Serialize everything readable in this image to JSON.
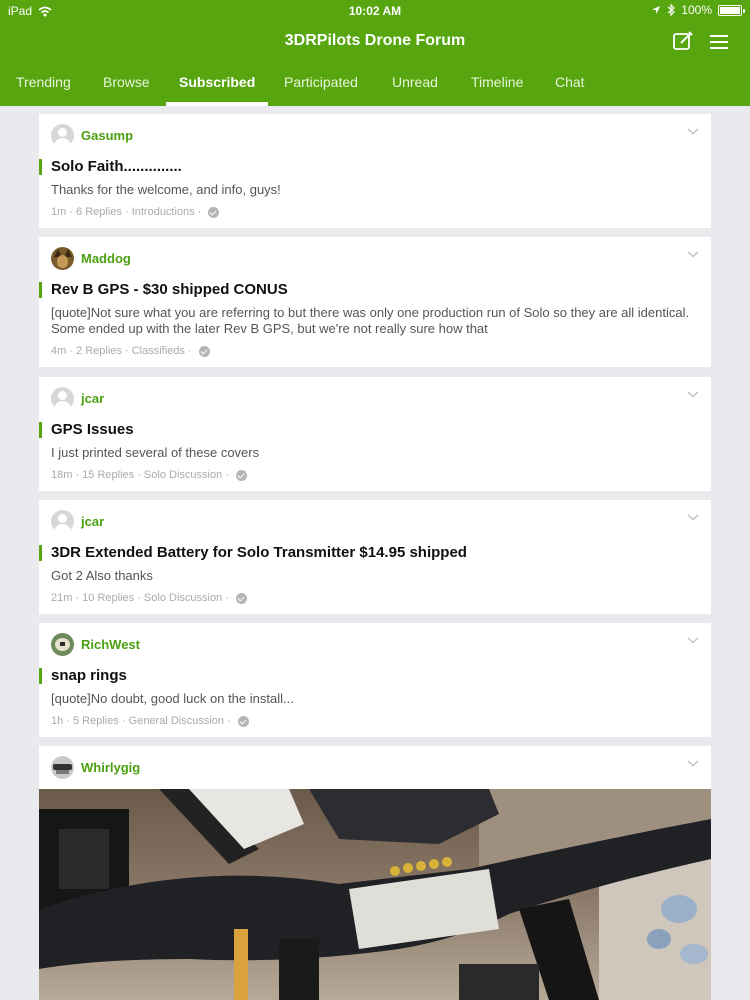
{
  "status_bar": {
    "device": "iPad",
    "time": "10:02 AM",
    "battery": "100%"
  },
  "app": {
    "title": "3DRPilots Drone Forum"
  },
  "tabs": [
    {
      "label": "Trending"
    },
    {
      "label": "Browse"
    },
    {
      "label": "Subscribed",
      "active": true
    },
    {
      "label": "Participated"
    },
    {
      "label": "Unread"
    },
    {
      "label": "Timeline"
    },
    {
      "label": "Chat"
    }
  ],
  "posts": [
    {
      "username": "Gasump",
      "avatar": "default-avatar-icon",
      "title": "Solo Faith..............",
      "snippet": "Thanks for the welcome, and info, guys!",
      "meta": "1m · 6 Replies · Introductions ·"
    },
    {
      "username": "Maddog",
      "avatar": "dog-avatar",
      "title": "Rev B GPS - $30 shipped CONUS",
      "snippet": "[quote]Not sure what you are referring to but there was only one production run of Solo so they are all identical.  Some ended up with the later Rev B GPS, but we're not really sure how that",
      "meta": "4m · 2 Replies · Classifieds ·"
    },
    {
      "username": "jcar",
      "avatar": "default-avatar-icon",
      "title": "GPS Issues",
      "snippet": "I just printed several of these covers",
      "meta": "18m · 15 Replies · Solo Discussion ·"
    },
    {
      "username": "jcar",
      "avatar": "default-avatar-icon",
      "title": "3DR  Extended Battery for Solo Transmitter $14.95 shipped",
      "snippet": "Got 2 Also thanks",
      "meta": "21m · 10 Replies · Solo Discussion ·"
    },
    {
      "username": "RichWest",
      "avatar": "photo-avatar",
      "title": "snap rings",
      "snippet": "[quote]No doubt, good luck on the install...",
      "meta": "1h · 5 Replies · General Discussion ·"
    }
  ],
  "photo_post": {
    "username": "Whirlygig",
    "avatar": "drone-avatar",
    "image": "drone-photo"
  },
  "colors": {
    "brand": "#57a50f",
    "username": "#4ba010",
    "background": "#e9e9ee"
  }
}
